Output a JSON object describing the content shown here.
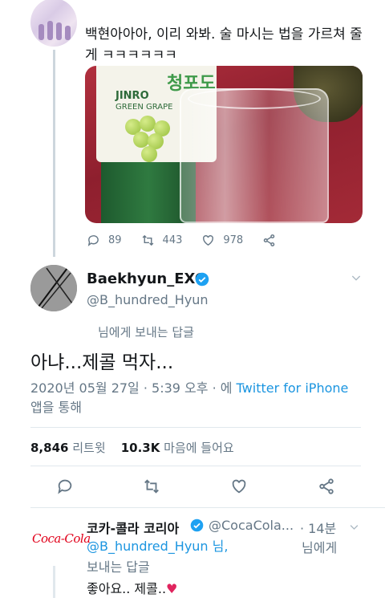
{
  "parent_tweet": {
    "text": "백현아아아, 이리 와봐. 술 마시는 법을 가르쳐 줄게 ㅋㅋㅋㅋㅋㅋ",
    "image_icon": "soju-bottle-and-glass-photo",
    "bottle_brand": "JINRO",
    "bottle_flavor": "GREEN GRAPE",
    "bottle_label_kor": "청포도",
    "replies": "89",
    "retweets": "443",
    "likes": "978"
  },
  "main_tweet": {
    "display_name": "Baekhyun_EXO",
    "handle": "@B_hundred_Hyun",
    "reply_to": "님에게 보내는 답글",
    "text": "아냐...제콜 먹자...",
    "timestamp": "2020년 05월 27일 · 5:39 오후 · 에 ",
    "source_link": "Twitter for iPhone",
    "source_suffix": " 앱을 통해",
    "retweet_count": "8,846",
    "retweet_label": "리트윗",
    "like_count": "10.3K",
    "like_label": "마음에 들어요"
  },
  "reply_tweet": {
    "avatar_logo": "Coca-Cola",
    "display_name": "코카-콜라 코리아",
    "handle": "@CocaCola...",
    "time": "· 14분",
    "mention": "@B_hundred_Hyun 님,",
    "suffix": "님에게",
    "suffix2": "보내는 답글",
    "text": "좋아요.. 제콜..",
    "heart": "♥",
    "heart_color": "#e0245e"
  },
  "colors": {
    "link": "#1b95e0",
    "muted": "#657786",
    "verified": "#1da1f2"
  }
}
